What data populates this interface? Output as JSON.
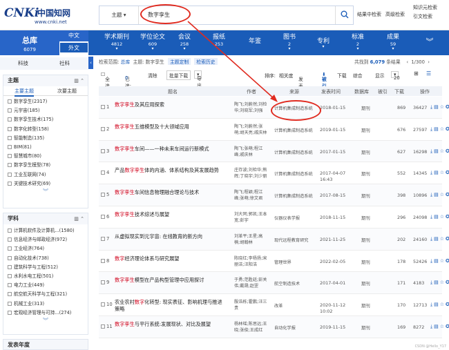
{
  "logo": {
    "mark": "CNKi",
    "cn": "中国知网",
    "url": "www.cnki.net"
  },
  "search": {
    "scope": "主题",
    "value": "数字孪生",
    "btn1": "结果中检索",
    "btn2": "高级检索",
    "btn3": "知识元检索",
    "btn4": "引文检索"
  },
  "db": {
    "zongku": "总库",
    "count": "6079",
    "zhongwen": "中文",
    "waiwen": "外文"
  },
  "nav": [
    {
      "label": "学术期刊",
      "count": "4812"
    },
    {
      "label": "学位论文",
      "count": "609"
    },
    {
      "label": "会议",
      "count": "258"
    },
    {
      "label": "报纸",
      "count": "253"
    },
    {
      "label": "年鉴",
      "count": ""
    },
    {
      "label": "图书",
      "count": "2"
    },
    {
      "label": "专利",
      "count": ""
    },
    {
      "label": "标准",
      "count": "2"
    },
    {
      "label": "成果",
      "count": "59"
    }
  ],
  "subtabs": {
    "a": "科技",
    "b": "社科"
  },
  "crumb": {
    "label": "检索范围:",
    "scope": "总库",
    "subject": "主题: 数字孪生",
    "define": "主题定制",
    "history": "检索历史"
  },
  "total": {
    "prefix": "共找到",
    "count": "6,079",
    "suffix": "条结果",
    "page": "1/300"
  },
  "toolbar": {
    "selectall": "全选",
    "selected": "已选:",
    "selected_n": "0",
    "clear": "清除",
    "download": "批量下载",
    "export": "导出与分析",
    "sort": "排序:",
    "relevance": "相关度",
    "date": "发表时间",
    "cited": "被引",
    "downloads": "下载",
    "composite": "综合",
    "display": "显示",
    "per": "20"
  },
  "thead": {
    "title": "题名",
    "author": "作者",
    "source": "来源",
    "date": "发表时间",
    "db": "数据库",
    "cited": "被引",
    "dl": "下载",
    "ops": "操作"
  },
  "subject_panel": {
    "title": "主题",
    "tab_main": "主要主题",
    "tab_sub": "次要主题",
    "items": [
      "数字孪生(2317)",
      "元宇宙(185)",
      "数字孪生技术(175)",
      "数字化转型(158)",
      "智能制造(135)",
      "BIM(81)",
      "智慧城市(80)",
      "数字孪生模型(78)",
      "工业互联网(74)",
      "关键技术研究(69)"
    ]
  },
  "discipline_panel": {
    "title": "学科",
    "items": [
      "计算机软件及计算机...(1580)",
      "信息经济与邮政经济(972)",
      "工业经济(764)",
      "自动化技术(738)",
      "建筑科学与工程(512)",
      "水利水电工程(501)",
      "电力工业(449)",
      "航空航天科学与工程(321)",
      "机械工业(313)",
      "宏观经济管理与可持...(274)"
    ]
  },
  "year_panel": {
    "title": "发表年度"
  },
  "rows": [
    {
      "n": "1",
      "pre": "",
      "kw": "数字孪生",
      "post": "及其应用探索",
      "author": "陶飞;刘蔚然;刘检华;刘晓军;刘强",
      "source": "计算机集成制造系统",
      "date": "2018-01-15",
      "db": "期刊",
      "cited": "869",
      "dl": "36427"
    },
    {
      "n": "2",
      "pre": "",
      "kw": "数字孪生",
      "post": "五维模型及十大领域应用",
      "author": "陶飞;刘蔚然;张萌;胡天亮;戚庆林",
      "source": "计算机集成制造系统",
      "date": "2019-01-15",
      "db": "期刊",
      "cited": "676",
      "dl": "27597"
    },
    {
      "n": "3",
      "pre": "",
      "kw": "数字孪生",
      "post": "车间——一种未来车间运行新模式",
      "author": "陶飞;张萌;程江峰;戚庆林",
      "source": "计算机集成制造系统",
      "date": "2017-01-15",
      "db": "期刊",
      "cited": "627",
      "dl": "16298"
    },
    {
      "n": "4",
      "pre": "产品",
      "kw": "数字孪生",
      "post": "体的内涵、体系结构及其发展趋势",
      "author": "庄存波;刘检华;熊辉;丁晓宇;刘少丽",
      "source": "计算机集成制造系统",
      "date": "2017-04-07 16:43",
      "db": "期刊",
      "cited": "552",
      "dl": "14345"
    },
    {
      "n": "5",
      "pre": "",
      "kw": "数字孪生",
      "post": "车间信息物理融合理论与技术",
      "author": "陶飞;程颖;程江峰;张萌;徐文君",
      "source": "计算机集成制造系统",
      "date": "2017-08-15",
      "db": "期刊",
      "cited": "398",
      "dl": "10896"
    },
    {
      "n": "6",
      "pre": "",
      "kw": "数字孪生",
      "post": "技术综述与展望",
      "author": "刘大同;郭凯;王本宽;彭宇",
      "source": "仪器仪表学报",
      "date": "2018-11-15",
      "db": "期刊",
      "cited": "296",
      "dl": "24098"
    },
    {
      "n": "7",
      "pre": "从虚拟现实到元宇宙: 在线教育的新方向",
      "kw": "",
      "post": "",
      "author": "刘革平;王星;高楠;胡翰林",
      "source": "现代远程教育研究",
      "date": "2021-11-25",
      "db": "期刊",
      "cited": "202",
      "dl": "24160"
    },
    {
      "n": "8",
      "pre": "",
      "kw": "数字",
      "post": "经济理论体系与研究展望",
      "author": "陈晓红;李杨扬;宋丽洁;汪阳洁",
      "source": "管理世界",
      "date": "2022-02-05",
      "db": "期刊",
      "cited": "178",
      "dl": "52426"
    },
    {
      "n": "9",
      "pre": "",
      "kw": "数字孪生",
      "post": "模型在产品构型管理中应用探讨",
      "author": "于勇;范胜廷;彭关伟;戴晟;赵罡",
      "source": "航空制造技术",
      "date": "2017-04-01",
      "db": "期刊",
      "cited": "171",
      "dl": "4183"
    },
    {
      "n": "10",
      "pre": "农业农村",
      "kw": "数字",
      "post": "化转型: 现实表征、影响机理与推进策略",
      "author": "殷浩栋;霍鹏;汪三贵",
      "source": "改革",
      "date": "2020-11-12 10:02",
      "db": "期刊",
      "cited": "170",
      "dl": "12713"
    },
    {
      "n": "11",
      "pre": "",
      "kw": "数字孪生",
      "post": "与平行系统:发展现状、对比及展望",
      "author": "杨林瑶;陈思远;王晓;张俊;王成红",
      "source": "自动化学报",
      "date": "2019-11-15",
      "db": "期刊",
      "cited": "169",
      "dl": "8272"
    }
  ],
  "watermark": "CSDN @Hello_Y17"
}
